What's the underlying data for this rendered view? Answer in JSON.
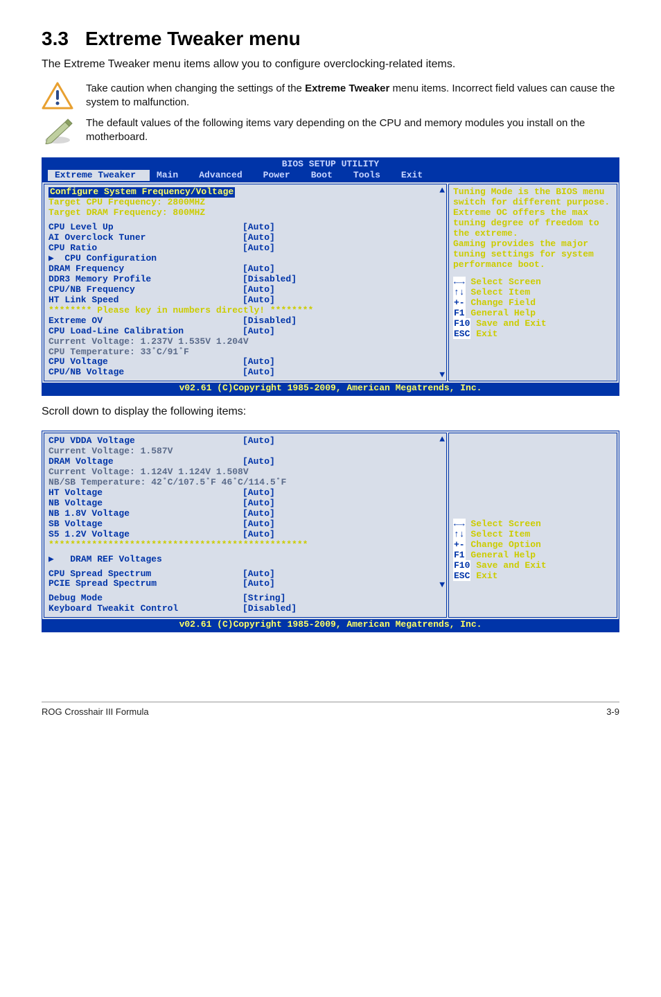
{
  "sectionNumber": "3.3",
  "sectionTitle": "Extreme Tweaker menu",
  "intro": "The Extreme Tweaker menu items allow you to configure overclocking-related items.",
  "callouts": {
    "warn_pre": "Take caution when changing the settings of the ",
    "warn_bold": "Extreme Tweaker",
    "warn_post": " menu items. Incorrect field values can cause the system to malfunction.",
    "note": "The default values of the following items vary depending on the CPU and memory modules you install on the motherboard."
  },
  "bios": {
    "title": "BIOS SETUP UTILITY",
    "tabs": [
      "Extreme Tweaker",
      "Main",
      "Advanced",
      "Power",
      "Boot",
      "Tools",
      "Exit"
    ],
    "activeTab": "Extreme Tweaker",
    "footer": "v02.61 (C)Copyright 1985-2009, American Megatrends, Inc.",
    "left1": {
      "heading": "Configure System Frequency/Voltage",
      "targetCpu": "Target CPU Frequency: 2800MHZ",
      "targetDram": "Target DRAM Frequency: 800MHZ",
      "rows": [
        {
          "label": "CPU Level Up",
          "value": "[Auto]"
        },
        {
          "label": "AI Overclock Tuner",
          "value": "[Auto]"
        },
        {
          "label": "CPU Ratio",
          "value": "[Auto]"
        },
        {
          "label": "▶  CPU Configuration",
          "value": ""
        },
        {
          "label": "DRAM Frequency",
          "value": "[Auto]"
        },
        {
          "label": "DDR3 Memory Profile",
          "value": "[Disabled]"
        },
        {
          "label": "CPU/NB Frequency",
          "value": "[Auto]"
        },
        {
          "label": "HT Link Speed",
          "value": "[Auto]"
        }
      ],
      "banner": "******** Please key in numbers directly! ********",
      "rows2": [
        {
          "label": "Extreme OV",
          "value": "[Disabled]"
        },
        {
          "labelBoldPart": "CPU",
          "labelRest": " Load-Line Calibration",
          "value": "[Auto]"
        }
      ],
      "curVolt": "Current Voltage: 1.237V  1.535V  1.204V",
      "cpuTemp": "CPU Temperature: 33˚C/91˚F",
      "rows3": [
        {
          "label": "CPU Voltage",
          "value": "[Auto]"
        },
        {
          "label": "CPU/NB Voltage",
          "value": "[Auto]"
        }
      ]
    },
    "right1": {
      "desc": "Tuning Mode is the BIOS menu switch for different purpose. Extreme OC offers the max tuning degree of freedom to the extreme.\nGaming provides the major tuning settings for system performance boot.",
      "nav": [
        {
          "key": "←→",
          "txt": "Select Screen"
        },
        {
          "key": "↑↓",
          "txt": "Select Item"
        },
        {
          "key": "+-",
          "txt": "Change Field"
        },
        {
          "key": "F1",
          "txt": "General Help"
        },
        {
          "key": "F10",
          "txt": "Save and Exit"
        },
        {
          "key": "ESC",
          "txt": "Exit"
        }
      ]
    },
    "left2": {
      "rows": [
        {
          "label": "CPU VDDA Voltage",
          "value": "[Auto]"
        }
      ],
      "curVolt": "Current Voltage: 1.587V",
      "rows2": [
        {
          "label": "DRAM Voltage",
          "value": "[Auto]"
        }
      ],
      "curVolt2": "Current Voltage: 1.124V  1.124V  1.508V",
      "nbsb": "NB/SB Temperature: 42˚C/107.5˚F  46˚C/114.5˚F",
      "rows3": [
        {
          "label": "HT Voltage",
          "value": "[Auto]"
        },
        {
          "label": "NB Voltage",
          "value": "[Auto]"
        },
        {
          "label": "NB 1.8V Voltage",
          "value": "[Auto]"
        },
        {
          "label": "SB Voltage",
          "value": "[Auto]"
        },
        {
          "label": "S5 1.2V Voltage",
          "value": "[Auto]"
        }
      ],
      "stars": "************************************************",
      "submenu": "▶   DRAM REF Voltages",
      "rows4": [
        {
          "label": "CPU Spread Spectrum",
          "value": "[Auto]"
        },
        {
          "label": "PCIE Spread Spectrum",
          "value": "[Auto]"
        }
      ],
      "rows5": [
        {
          "label": "Debug Mode",
          "value": "[String]"
        },
        {
          "label": "Keyboard Tweakit Control",
          "value": "[Disabled]"
        }
      ]
    },
    "right2": {
      "nav": [
        {
          "key": "←→",
          "txt": "Select Screen"
        },
        {
          "key": "↑↓",
          "txt": "Select Item"
        },
        {
          "key": "+-",
          "txt": "Change Option"
        },
        {
          "key": "F1",
          "txt": "General Help"
        },
        {
          "key": "F10",
          "txt": "Save and Exit"
        },
        {
          "key": "ESC",
          "txt": "Exit"
        }
      ]
    }
  },
  "scrollNote": "Scroll down to display the following items:",
  "footer": {
    "left": "ROG Crosshair III Formula",
    "right": "3-9"
  }
}
